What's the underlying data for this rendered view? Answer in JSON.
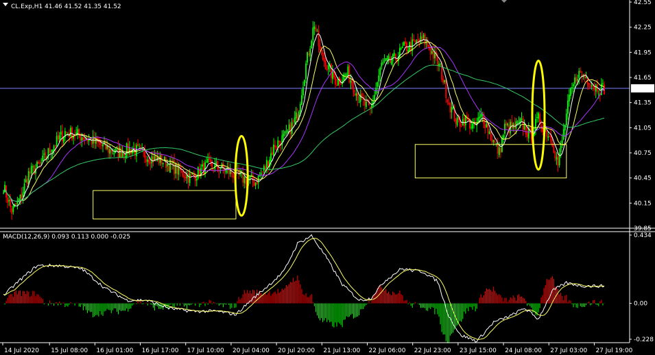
{
  "chart_data": [
    {
      "type": "candlestick",
      "title": "CL.Exp,H1",
      "ohlc_readout": "41.46 41.52 41.35 41.52",
      "ylim": [
        39.85,
        42.55
      ],
      "y_ticks": [
        "42.55",
        "42.25",
        "41.95",
        "41.65",
        "41.35",
        "41.05",
        "40.75",
        "40.45",
        "40.15",
        "39.85"
      ],
      "current_price": "41.52",
      "x_ticks": [
        "14 Jul 2020",
        "15 Jul 08:00",
        "16 Jul 01:00",
        "16 Jul 17:00",
        "17 Jul 10:00",
        "20 Jul 04:00",
        "20 Jul 20:00",
        "21 Jul 13:00",
        "22 Jul 06:00",
        "22 Jul 23:00",
        "23 Jul 15:00",
        "24 Jul 08:00",
        "27 Jul 03:00",
        "27 Jul 19:00"
      ],
      "colors": {
        "up": "#00ff00",
        "down": "#ff0000",
        "ma_fast": "#ffffff",
        "ma_mid": "#ffff66",
        "ma_slow": "#aa33ff",
        "ma_long": "#33cc66",
        "price_line": "#7f7fff",
        "highlight_box": "#ffff66",
        "ellipse": "#ffff00"
      },
      "anchors": [
        [
          0,
          40.35
        ],
        [
          6,
          40.05
        ],
        [
          12,
          40.2
        ],
        [
          18,
          40.5
        ],
        [
          26,
          40.6
        ],
        [
          34,
          40.8
        ],
        [
          44,
          41.0
        ],
        [
          56,
          40.95
        ],
        [
          68,
          40.85
        ],
        [
          80,
          40.75
        ],
        [
          92,
          40.8
        ],
        [
          104,
          40.7
        ],
        [
          114,
          40.65
        ],
        [
          124,
          40.55
        ],
        [
          134,
          40.45
        ],
        [
          146,
          40.6
        ],
        [
          158,
          40.55
        ],
        [
          170,
          40.45
        ],
        [
          180,
          40.4
        ],
        [
          186,
          40.55
        ],
        [
          194,
          40.85
        ],
        [
          202,
          40.95
        ],
        [
          210,
          41.2
        ],
        [
          216,
          41.8
        ],
        [
          222,
          42.3
        ],
        [
          226,
          41.95
        ],
        [
          232,
          41.75
        ],
        [
          238,
          41.6
        ],
        [
          246,
          41.7
        ],
        [
          254,
          41.4
        ],
        [
          262,
          41.25
        ],
        [
          270,
          41.8
        ],
        [
          278,
          41.85
        ],
        [
          286,
          42.0
        ],
        [
          294,
          42.05
        ],
        [
          300,
          42.1
        ],
        [
          306,
          41.95
        ],
        [
          312,
          41.75
        ],
        [
          318,
          41.35
        ],
        [
          324,
          41.1
        ],
        [
          330,
          41.15
        ],
        [
          336,
          41.05
        ],
        [
          342,
          41.2
        ],
        [
          348,
          40.95
        ],
        [
          354,
          40.75
        ],
        [
          358,
          41.05
        ],
        [
          364,
          41.05
        ],
        [
          370,
          41.1
        ],
        [
          376,
          40.95
        ],
        [
          382,
          41.15
        ],
        [
          386,
          41.05
        ],
        [
          392,
          40.9
        ],
        [
          396,
          40.6
        ],
        [
          400,
          41.0
        ],
        [
          404,
          41.4
        ],
        [
          410,
          41.7
        ],
        [
          416,
          41.65
        ],
        [
          422,
          41.55
        ],
        [
          426,
          41.52
        ]
      ],
      "highlight_boxes": [
        {
          "x0": 64,
          "x1": 166,
          "y0": 40.3,
          "y1": 39.96
        },
        {
          "x0": 294,
          "x1": 402,
          "y0": 40.85,
          "y1": 40.45
        }
      ],
      "ellipses": [
        {
          "bar": 170,
          "y_top": 40.95,
          "y_bottom": 40.0
        },
        {
          "bar": 382,
          "y_top": 41.85,
          "y_bottom": 40.55
        }
      ]
    },
    {
      "type": "macd",
      "label": "MACD(12,26,9) 0.093 0.113 0.000 -0.025",
      "ylim": [
        -0.228,
        0.434
      ],
      "y_ticks": [
        "0.434",
        "0.00",
        "-0.228"
      ],
      "anchors": [
        [
          0,
          0.05
        ],
        [
          12,
          0.15
        ],
        [
          24,
          0.24
        ],
        [
          40,
          0.24
        ],
        [
          56,
          0.22
        ],
        [
          72,
          0.1
        ],
        [
          88,
          0.02
        ],
        [
          102,
          0.02
        ],
        [
          118,
          -0.03
        ],
        [
          134,
          -0.05
        ],
        [
          152,
          -0.05
        ],
        [
          166,
          -0.07
        ],
        [
          178,
          0.03
        ],
        [
          190,
          0.12
        ],
        [
          200,
          0.2
        ],
        [
          210,
          0.38
        ],
        [
          220,
          0.43
        ],
        [
          230,
          0.3
        ],
        [
          242,
          0.12
        ],
        [
          254,
          0.02
        ],
        [
          262,
          0.03
        ],
        [
          272,
          0.14
        ],
        [
          284,
          0.22
        ],
        [
          300,
          0.2
        ],
        [
          310,
          0.14
        ],
        [
          318,
          -0.08
        ],
        [
          326,
          -0.2
        ],
        [
          338,
          -0.24
        ],
        [
          350,
          -0.12
        ],
        [
          362,
          -0.08
        ],
        [
          372,
          -0.03
        ],
        [
          382,
          -0.1
        ],
        [
          392,
          0.08
        ],
        [
          402,
          0.13
        ],
        [
          414,
          0.11
        ],
        [
          426,
          0.11
        ]
      ]
    }
  ]
}
